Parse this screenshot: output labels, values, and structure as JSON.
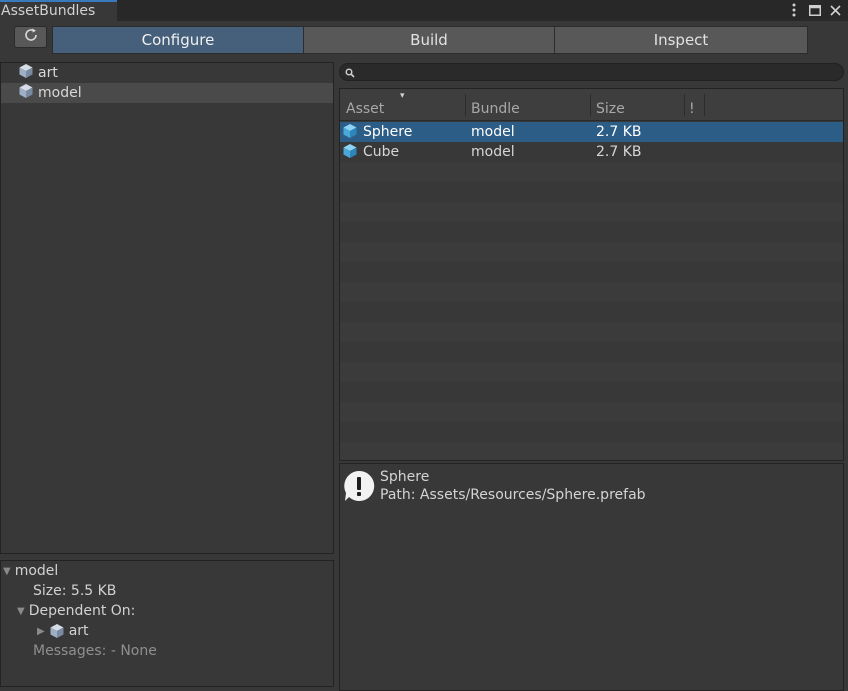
{
  "window": {
    "tab_title": "AssetBundles",
    "menu_icon": "kebab-menu-icon",
    "maximize_icon": "maximize-icon",
    "close_icon": "close-icon"
  },
  "toolbar": {
    "refresh_icon": "refresh-icon",
    "tabs": [
      {
        "label": "Configure",
        "active": true
      },
      {
        "label": "Build",
        "active": false
      },
      {
        "label": "Inspect",
        "active": false
      }
    ]
  },
  "bundles": [
    {
      "name": "art",
      "icon": "cube-icon",
      "selected": false
    },
    {
      "name": "model",
      "icon": "cube-icon",
      "selected": true
    }
  ],
  "bundle_details": {
    "name": "model",
    "size": "Size: 5.5 KB",
    "dependent_on_label": "Dependent On:",
    "dependency": "art",
    "messages": "Messages: - None"
  },
  "search": {
    "value": "",
    "icon": "search-icon"
  },
  "asset_table": {
    "sort_indicator": "▾",
    "columns": [
      "Asset",
      "Bundle",
      "Size",
      "!"
    ],
    "rows": [
      {
        "asset": "Sphere",
        "bundle": "model",
        "size": "2.7 KB",
        "selected": true
      },
      {
        "asset": "Cube",
        "bundle": "model",
        "size": "2.7 KB",
        "selected": false
      }
    ]
  },
  "message": {
    "icon": "warning-bubble-icon",
    "title": "Sphere",
    "path": "Path: Assets/Resources/Sphere.prefab"
  },
  "colors": {
    "accent_tab": "#3a79bb",
    "active_button": "#46607c",
    "row_selection": "#2c5d87",
    "background": "#383838"
  }
}
